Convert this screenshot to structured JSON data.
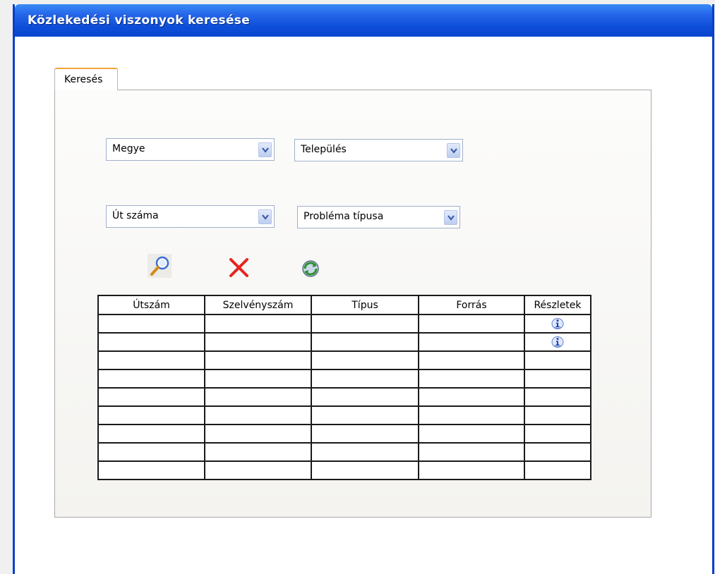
{
  "window": {
    "title": "Közlekedési viszonyok keresése"
  },
  "tabs": [
    {
      "label": "Keresés"
    }
  ],
  "filters": {
    "county": {
      "value": "Megye"
    },
    "settlement": {
      "value": "Település"
    },
    "road_number": {
      "value": "Út száma"
    },
    "problem_type": {
      "value": "Probléma típusa"
    }
  },
  "toolbar": {
    "search_icon": "search-icon",
    "clear_icon": "clear-icon",
    "refresh_icon": "refresh-icon"
  },
  "table": {
    "columns": [
      "Útszám",
      "Szelvényszám",
      "Típus",
      "Forrás",
      "Részletek"
    ],
    "row_count": 9,
    "rows_with_details_icon": [
      0,
      1
    ]
  },
  "colors": {
    "titlebar": "#0d4ed8",
    "tab_accent": "#f4a43a",
    "clear_icon": "#e8231f"
  }
}
